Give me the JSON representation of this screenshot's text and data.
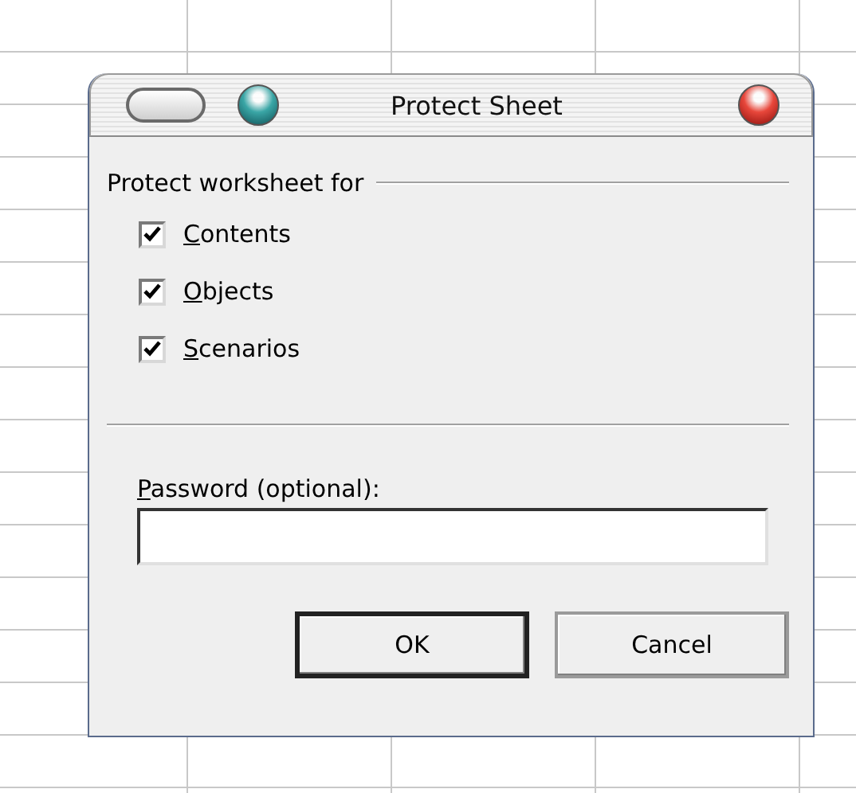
{
  "window": {
    "title": "Protect Sheet"
  },
  "protect_group": {
    "label": "Protect worksheet for"
  },
  "options": [
    {
      "label": "Contents",
      "mnemonic": true,
      "checked": true
    },
    {
      "label": "Objects",
      "mnemonic": true,
      "checked": true
    },
    {
      "label": "Scenarios",
      "mnemonic": true,
      "checked": true
    }
  ],
  "password": {
    "label": "Password (optional):",
    "mnemonic": true
  },
  "buttons": [
    {
      "label": "OK",
      "default": true
    },
    {
      "label": "Cancel",
      "default": false
    }
  ]
}
